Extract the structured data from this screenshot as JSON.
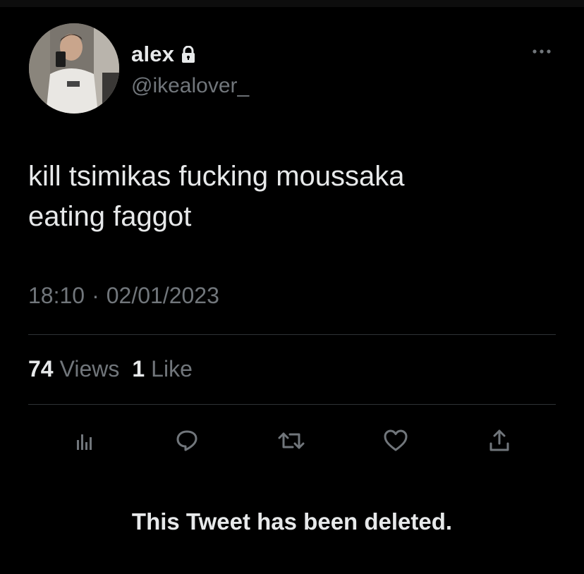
{
  "profile": {
    "display_name": "alex",
    "handle": "@ikealover_",
    "avatar_icon": "avatar-photo",
    "protected_icon": "lock-icon"
  },
  "tweet": {
    "text_line1": "kill tsimikas fucking moussaka",
    "text_line2": "eating faggot",
    "time": "18:10",
    "separator": "·",
    "date": "02/01/2023"
  },
  "stats": {
    "views_count": "74",
    "views_label": "Views",
    "likes_count": "1",
    "likes_label": "Like"
  },
  "actions": [
    {
      "name": "analytics",
      "icon": "bar-chart-icon"
    },
    {
      "name": "reply",
      "icon": "speech-bubble-icon"
    },
    {
      "name": "retweet",
      "icon": "retweet-icon"
    },
    {
      "name": "like",
      "icon": "heart-icon"
    },
    {
      "name": "share",
      "icon": "share-icon"
    }
  ],
  "notice": {
    "deleted_text": "This Tweet has been deleted."
  },
  "colors": {
    "background": "#000000",
    "primary_text": "#e7e9ea",
    "secondary_text": "#71767b",
    "divider": "#2f3336"
  }
}
